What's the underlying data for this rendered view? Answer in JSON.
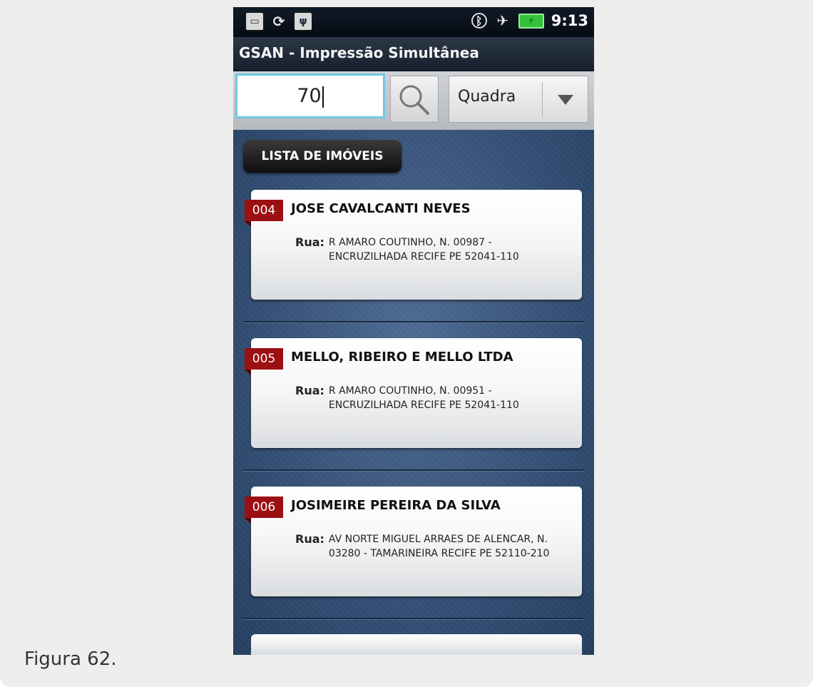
{
  "caption": "Figura 62.",
  "status_bar": {
    "time": "9:13",
    "left_icons": [
      "sd-card-icon",
      "sync-icon",
      "usb-icon"
    ],
    "right_icons": [
      "bluetooth-icon",
      "airplane-mode-icon",
      "battery-charging-icon"
    ]
  },
  "app": {
    "title": "GSAN - Impressão Simultânea"
  },
  "search": {
    "value": "70",
    "filter_selected": "Quadra"
  },
  "list": {
    "header": "LISTA DE IMÓVEIS",
    "items": [
      {
        "number": "004",
        "name": "JOSE CAVALCANTI NEVES",
        "address_label": "Rua:",
        "address": "R AMARO COUTINHO, N. 00987 - ENCRUZILHADA RECIFE PE 52041-110"
      },
      {
        "number": "005",
        "name": "MELLO, RIBEIRO E MELLO LTDA",
        "address_label": "Rua:",
        "address": "R AMARO COUTINHO, N. 00951 - ENCRUZILHADA RECIFE PE 52041-110"
      },
      {
        "number": "006",
        "name": "JOSIMEIRE PEREIRA DA SILVA",
        "address_label": "Rua:",
        "address": "AV NORTE MIGUEL ARRAES DE ALENCAR, N. 03280 - TAMARINEIRA RECIFE PE 52110-210"
      }
    ]
  },
  "colors": {
    "tag_red": "#9c0f12",
    "list_background": "#2f4a6e",
    "input_focus": "#6fc7e8"
  }
}
